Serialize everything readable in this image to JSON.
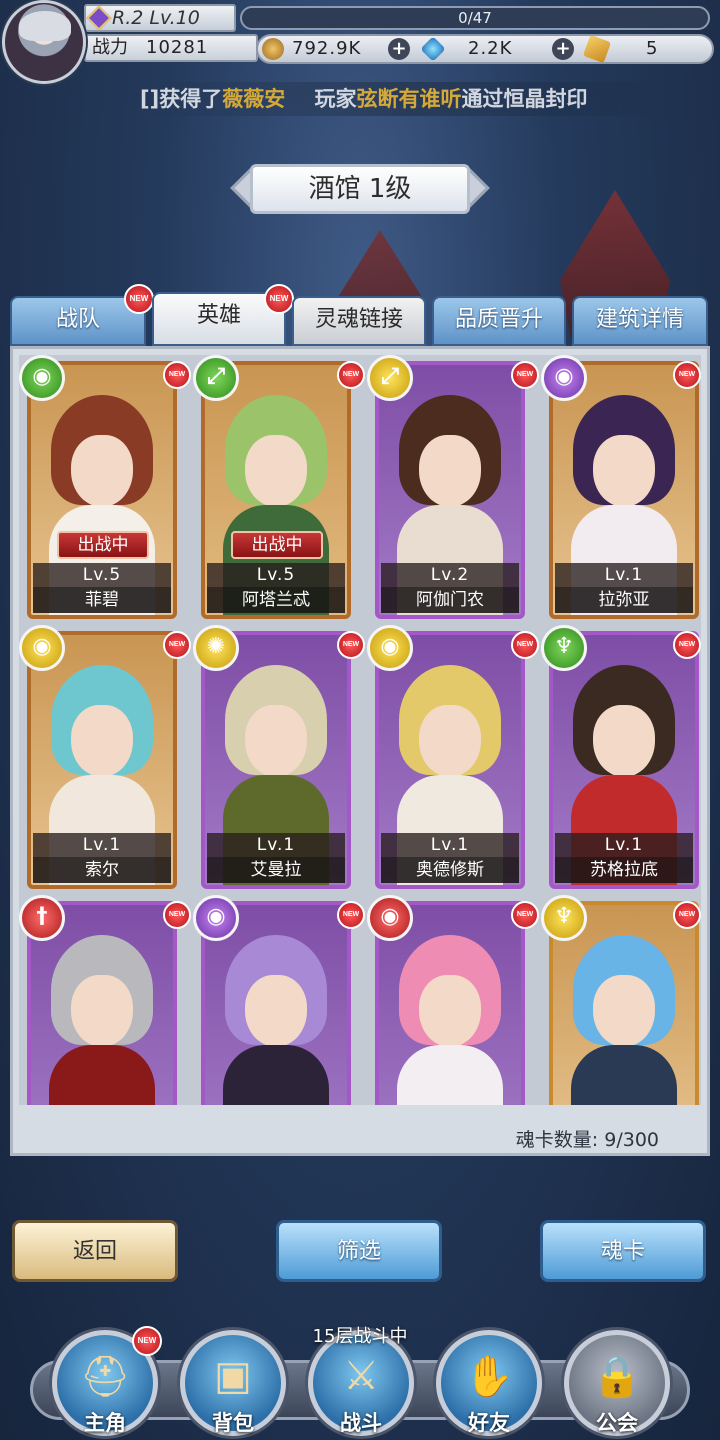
{
  "player": {
    "rank_level": "R.2 Lv.10",
    "exp": "0/47",
    "power_label": "战力",
    "power": "10281"
  },
  "resources": {
    "gold": "792.9K",
    "gems": "2.2K",
    "tickets": "5"
  },
  "ticker": {
    "part1": "[]获得了",
    "name1": "薇薇安",
    "part2": "玩家",
    "name2": "弦断有谁听",
    "part3": "通过恒晶封印"
  },
  "building_title": "酒馆 1级",
  "tabs": [
    {
      "label": "战队",
      "new": "NEW"
    },
    {
      "label": "英雄",
      "new": "NEW"
    },
    {
      "label": "灵魂链接"
    },
    {
      "label": "品质晋升"
    },
    {
      "label": "建筑详情"
    }
  ],
  "cards": [
    {
      "level": "Lv.5",
      "name": "菲碧",
      "deployed": "出战中",
      "new": "NEW"
    },
    {
      "level": "Lv.5",
      "name": "阿塔兰忒",
      "deployed": "出战中",
      "new": "NEW"
    },
    {
      "level": "Lv.2",
      "name": "阿伽门农",
      "new": "NEW"
    },
    {
      "level": "Lv.1",
      "name": "拉弥亚",
      "new": "NEW"
    },
    {
      "level": "Lv.1",
      "name": "索尔",
      "new": "NEW"
    },
    {
      "level": "Lv.1",
      "name": "艾曼拉",
      "new": "NEW"
    },
    {
      "level": "Lv.1",
      "name": "奥德修斯",
      "new": "NEW"
    },
    {
      "level": "Lv.1",
      "name": "苏格拉底",
      "new": "NEW"
    },
    {
      "new": "NEW"
    },
    {
      "new": "NEW"
    },
    {
      "new": "NEW"
    },
    {
      "new": "NEW"
    }
  ],
  "soul_card_count": "魂卡数量: 9/300",
  "buttons": {
    "back": "返回",
    "filter": "筛选",
    "soul_card": "魂卡"
  },
  "battle_status": "15层战斗中",
  "nav": [
    {
      "label": "主角",
      "new": "NEW"
    },
    {
      "label": "背包"
    },
    {
      "label": "战斗"
    },
    {
      "label": "好友"
    },
    {
      "label": "公会"
    }
  ],
  "colors": {
    "tab_blue": "#5e93c8",
    "card_orange": "#b06b2a",
    "card_purple": "#a458c7",
    "deployed_red": "#c73838"
  }
}
